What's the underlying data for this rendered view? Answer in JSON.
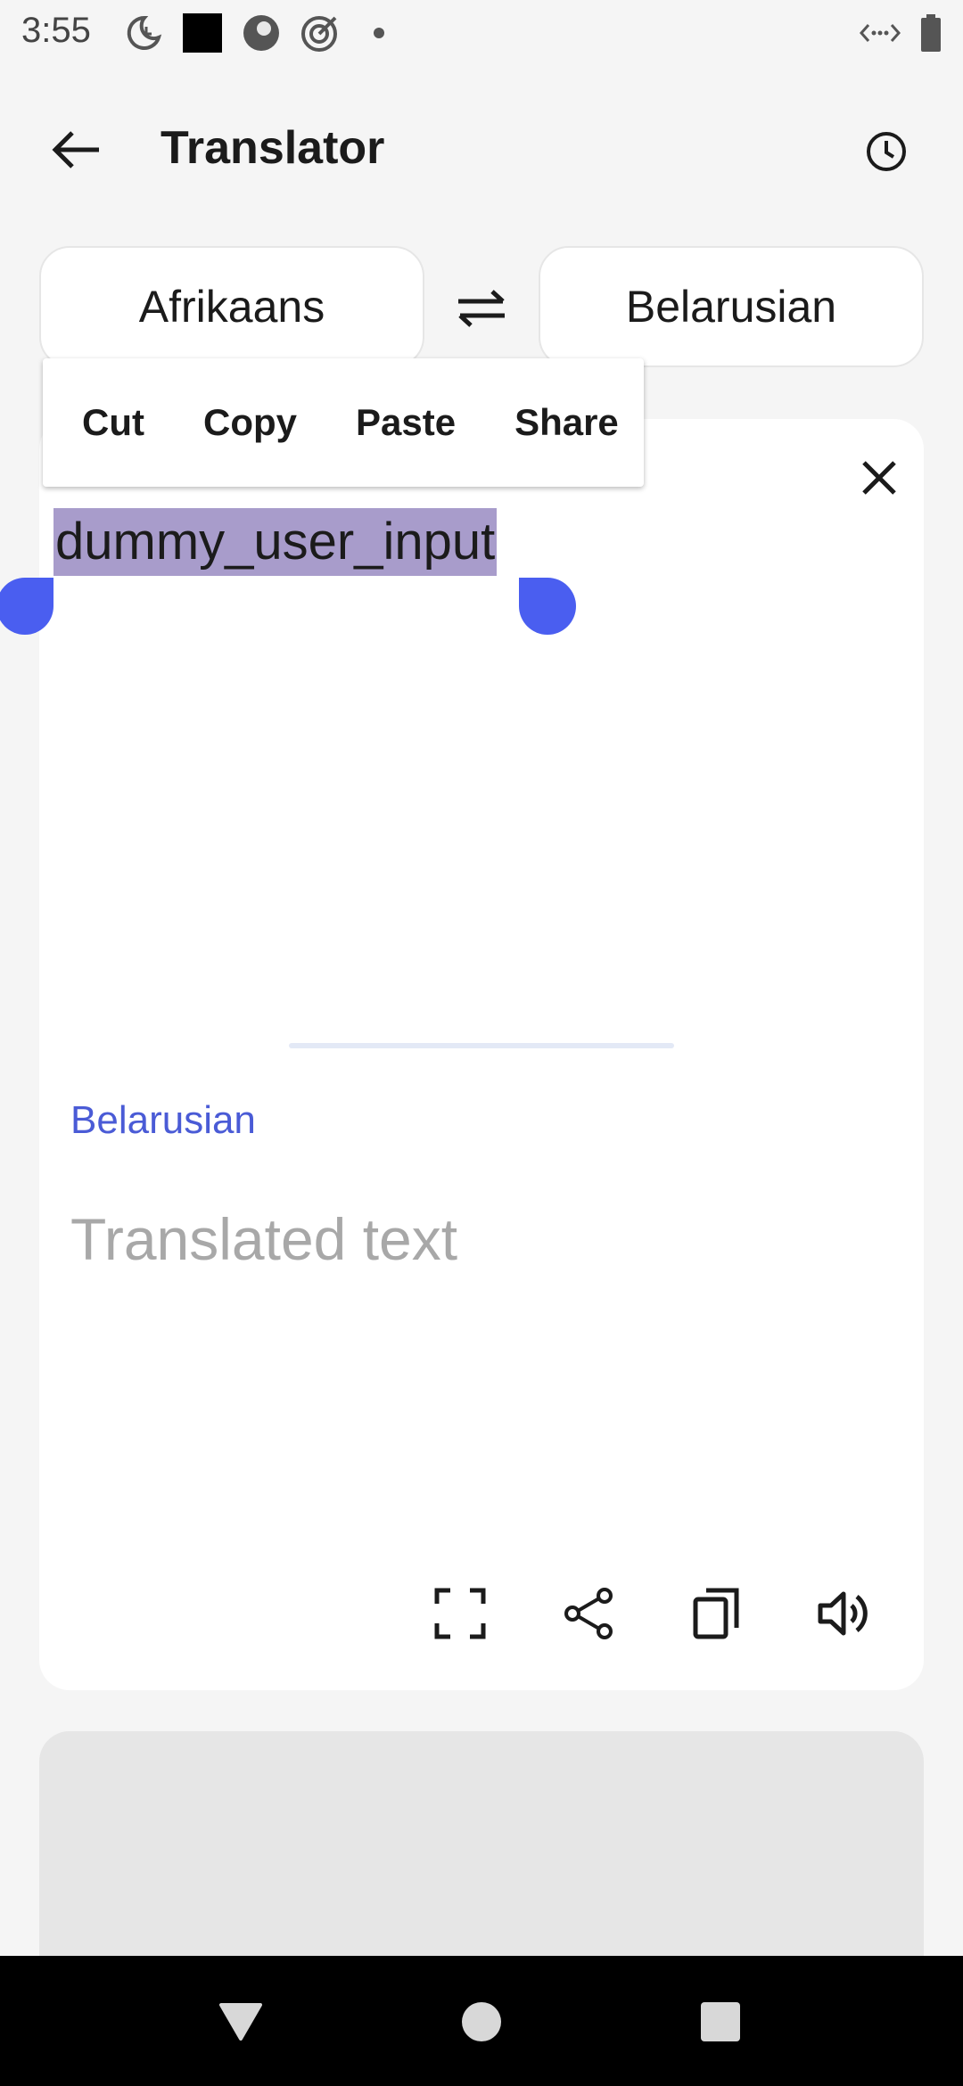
{
  "status_bar": {
    "time": "3:55",
    "left_icons": [
      "moon-clock-icon",
      "black-square-icon",
      "record-icon",
      "target-icon",
      "dot-icon"
    ],
    "right_icons": [
      "data-saver-icon",
      "battery-icon"
    ]
  },
  "app_bar": {
    "title": "Translator",
    "back_icon": "arrow-left-icon",
    "history_icon": "clock-icon"
  },
  "languages": {
    "source": "Afrikaans",
    "target": "Belarusian",
    "swap_icon": "swap-arrows-icon"
  },
  "context_menu": {
    "items": [
      "Cut",
      "Copy",
      "Paste",
      "Share"
    ]
  },
  "input": {
    "text": "dummy_user_input",
    "selected": true
  },
  "output": {
    "language_label": "Belarusian",
    "placeholder": "Translated text"
  },
  "actions": [
    "fullscreen-icon",
    "share-icon",
    "copy-icon",
    "speaker-icon"
  ],
  "nav": [
    "back-triangle-icon",
    "home-circle-icon",
    "recents-square-icon"
  ],
  "colors": {
    "accent": "#4a5ef0",
    "selection": "#a89ccb",
    "label_blue": "#4a5bd6",
    "background": "#f5f5f5"
  }
}
